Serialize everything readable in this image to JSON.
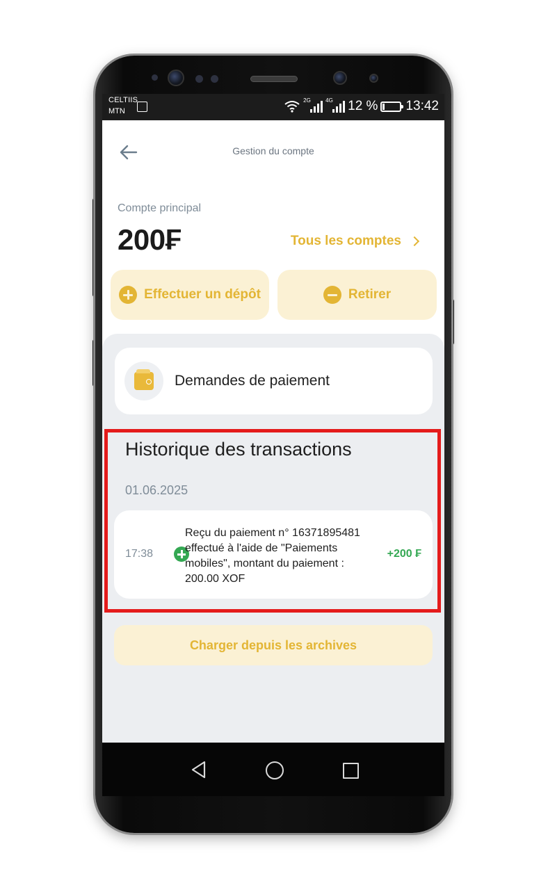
{
  "status_bar": {
    "carrier_1": "CELTIIS",
    "carrier_2": "MTN",
    "network_1": "2G",
    "network_2": "4G",
    "battery_percent": "12 %",
    "battery_level": 0.12,
    "time": "13:42"
  },
  "header": {
    "title": "Gestion du compte",
    "back_icon": "arrow-left-icon"
  },
  "account": {
    "label": "Compte principal",
    "balance": "200₣",
    "all_accounts_label": "Tous les comptes"
  },
  "actions": {
    "deposit_label": "Effectuer un dépôt",
    "withdraw_label": "Retirer"
  },
  "payment_requests": {
    "label": "Demandes de paiement",
    "icon": "wallet-icon"
  },
  "history": {
    "title": "Historique des transactions",
    "groups": [
      {
        "date": "01.06.2025",
        "transactions": [
          {
            "time": "17:38",
            "description": "Reçu du paiement n° 16371895481 effectué à l'aide de \"Paiements mobiles\", montant du paiement : 200.00 XOF",
            "amount": "+200 ₣",
            "type": "credit"
          }
        ]
      }
    ],
    "archive_button_label": "Charger depuis les archives"
  },
  "colors": {
    "accent": "#e3b534",
    "accent_bg": "#fbf1d4",
    "credit_green": "#34a853",
    "highlight_red": "#e41b1b",
    "panel_grey": "#eceef1"
  },
  "nav_bar": {
    "back_icon": "nav-back-triangle-icon",
    "home_icon": "nav-home-circle-icon",
    "recent_icon": "nav-recent-square-icon"
  }
}
